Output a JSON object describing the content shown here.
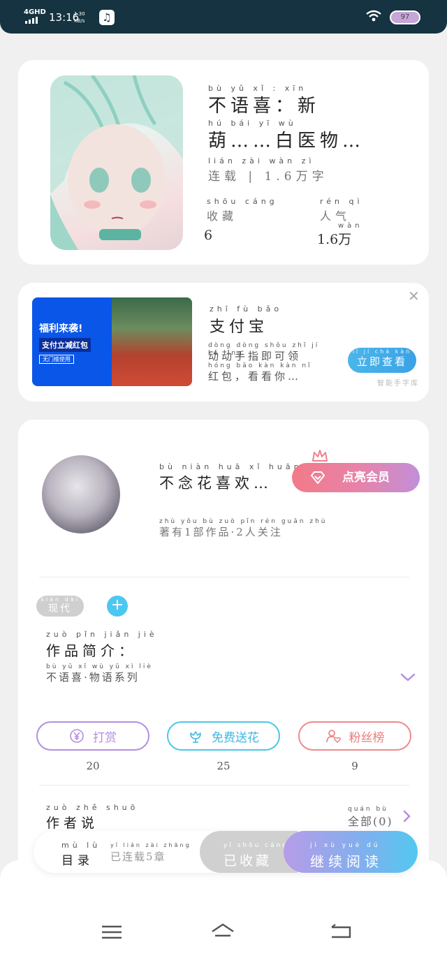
{
  "status_bar": {
    "network": "4GHD",
    "time": "13:16",
    "speed_value": "1.30",
    "speed_unit": "KB/s",
    "battery": "97"
  },
  "book": {
    "title_pinyin_1": "bù yǔ xǐ : xīn",
    "title_line_1": "不语喜：新",
    "title_pinyin_2": "hú bái yī wù",
    "title_line_2": "葫……白医物…",
    "meta_pinyin": "lián zài wàn zì",
    "meta": "连载 | 1.6万字",
    "stats": [
      {
        "pinyin": "shōu cáng",
        "label": "收藏",
        "value_pinyin": "",
        "value": "6"
      },
      {
        "pinyin": "rén qì",
        "label": "人气",
        "value_pinyin": "wàn",
        "value": "1.6万"
      }
    ]
  },
  "ad": {
    "banner_title": "福利来袭!",
    "banner_subtitle": "支付立减红包",
    "banner_note": "无门槛使用",
    "title_pinyin": "zhī fù bǎo",
    "title": "支付宝",
    "desc_pinyin_1": "dòng dòng shǒu zhǐ jí kě lǐng",
    "desc_1": "动动手指即可领",
    "desc_pinyin_2": "hóng bāo kàn kàn nǐ",
    "desc_2": "红包，看看你…",
    "button_pinyin": "lì jí chá kàn",
    "button": "立即查看",
    "close": "✕",
    "source": "智能手字库"
  },
  "author": {
    "name_pinyin": "bù niàn huā xǐ huān",
    "name": "不念花喜欢…",
    "info_pinyin": "zhù yǒu bù zuò pǐn rén guān zhù",
    "info": "著有1部作品·2人关注",
    "vip_button": "点亮会员",
    "tag_pinyin": "xiàn dài",
    "tag": "现代",
    "add_tag": "+",
    "intro_pinyin": "zuò pǐn jiǎn jiè",
    "intro_label": "作品简介：",
    "intro_text_pinyin": "bù yǔ xǐ wù yǔ xì liè",
    "intro_text": "不语喜·物语系列"
  },
  "actions": [
    {
      "label": "打赏",
      "count": "20"
    },
    {
      "label": "免费送花",
      "count": "25"
    },
    {
      "label": "粉丝榜",
      "count": "9"
    }
  ],
  "author_says": {
    "pinyin": "zuò zhě shuō",
    "label": "作者说",
    "all_pinyin": "quán bù",
    "all": "全部(0)"
  },
  "read_bar": {
    "catalog_pinyin": "mù lù",
    "catalog": "目录",
    "serial_pinyin": "yǐ lián zài zhāng",
    "serial": "已连载5章",
    "collect_pinyin": "yǐ shōu cáng",
    "collect": "已收藏",
    "read_pinyin": "jì xù yuè dú",
    "read": "继续阅读"
  },
  "colors": {
    "vip_gradient_start": "#f27a88",
    "vip_gradient_end": "#c28fd8",
    "reward": "#b48ee0",
    "flower": "#4cc8e8",
    "fans": "#ee8a8a",
    "read_gradient_start": "#b79ce8",
    "read_gradient_end": "#52c8f0"
  }
}
